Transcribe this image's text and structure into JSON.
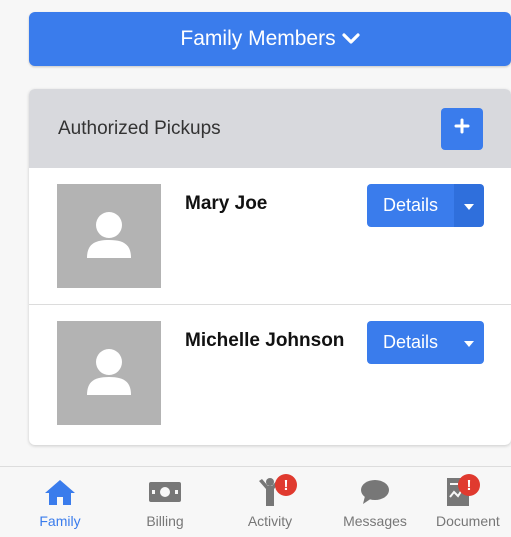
{
  "header": {
    "family_button_label": "Family Members"
  },
  "pickups_card": {
    "title": "Authorized Pickups",
    "items": [
      {
        "name": "Mary Joe",
        "details_label": "Details"
      },
      {
        "name": "Michelle Johnson",
        "details_label": "Details"
      }
    ]
  },
  "tabbar": {
    "tabs": [
      {
        "label": "Family",
        "icon": "home-icon",
        "active": true
      },
      {
        "label": "Billing",
        "icon": "money-icon"
      },
      {
        "label": "Activity",
        "icon": "activity-icon",
        "badge": "!"
      },
      {
        "label": "Messages",
        "icon": "chat-icon"
      },
      {
        "label": "Document",
        "icon": "document-icon",
        "badge": "!"
      }
    ]
  },
  "colors": {
    "primary": "#3a7cec",
    "badge": "#e03a2f",
    "avatar": "#b3b3b3"
  }
}
